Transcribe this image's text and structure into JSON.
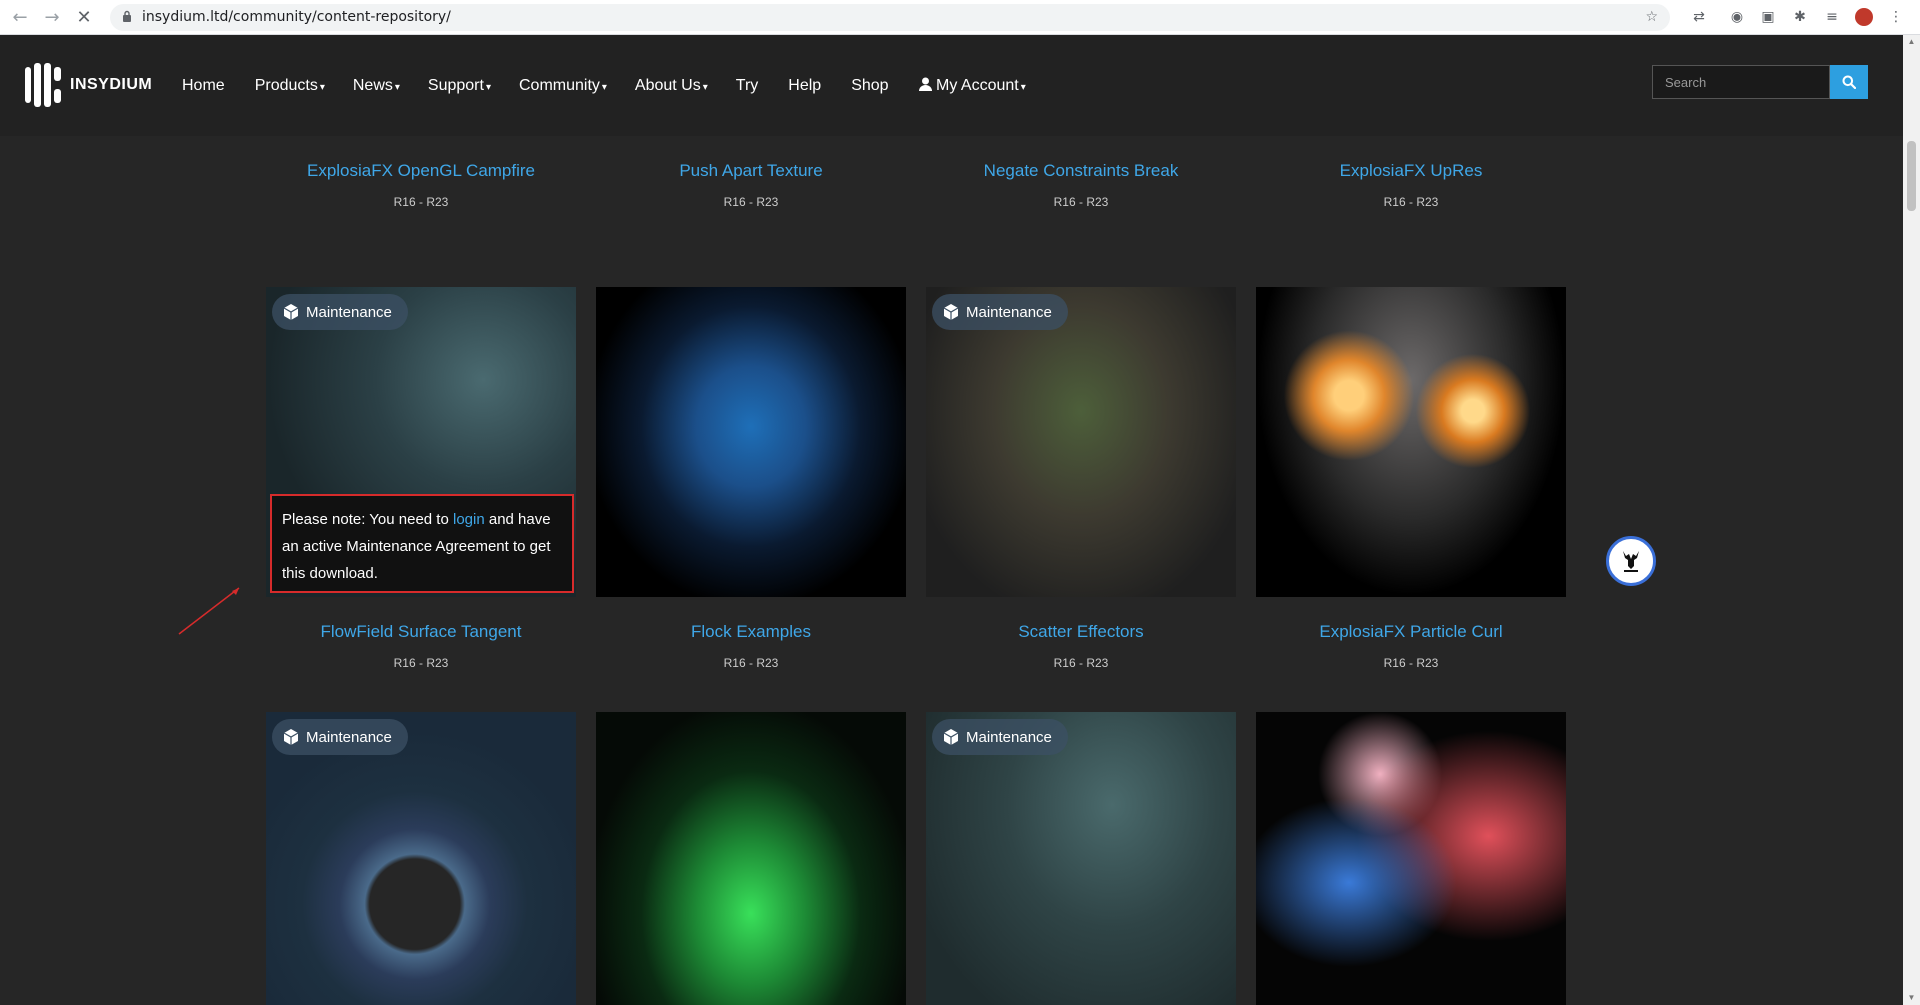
{
  "browser": {
    "url": "insydium.ltd/community/content-repository/"
  },
  "site": {
    "logo_text": "INSYDIUM",
    "nav": [
      {
        "label": "Home",
        "caret": ""
      },
      {
        "label": "Products",
        "caret": "▾"
      },
      {
        "label": "News",
        "caret": "▾"
      },
      {
        "label": "Support",
        "caret": "▾"
      },
      {
        "label": "Community",
        "caret": "▾"
      },
      {
        "label": "About Us",
        "caret": "▾"
      },
      {
        "label": "Try",
        "caret": ""
      },
      {
        "label": "Help",
        "caret": ""
      },
      {
        "label": "Shop",
        "caret": ""
      },
      {
        "label": "My Account",
        "caret": "▾"
      }
    ],
    "search_placeholder": "Search"
  },
  "badge_label": "Maintenance",
  "rows": [
    {
      "cards": [
        {
          "title": "ExplosiaFX OpenGL Campfire",
          "version": "R16 - R23",
          "maintenance": false,
          "thumb": "campfire"
        },
        {
          "title": "Push Apart Texture",
          "version": "R16 - R23",
          "maintenance": false,
          "thumb": "spheres"
        },
        {
          "title": "Negate Constraints Break",
          "version": "R16 - R23",
          "maintenance": false,
          "thumb": "bubbles"
        },
        {
          "title": "ExplosiaFX UpRes",
          "version": "R16 - R23",
          "maintenance": false,
          "thumb": "upres"
        }
      ]
    },
    {
      "cards": [
        {
          "title": "FlowField Surface Tangent",
          "version": "R16 - R23",
          "maintenance": true,
          "thumb": "flowfield"
        },
        {
          "title": "Flock Examples",
          "version": "R16 - R23",
          "maintenance": false,
          "thumb": "flock"
        },
        {
          "title": "Scatter Effectors",
          "version": "R16 - R23",
          "maintenance": true,
          "thumb": "scatter"
        },
        {
          "title": "ExplosiaFX Particle Curl",
          "version": "R16 - R23",
          "maintenance": false,
          "thumb": "fire"
        }
      ]
    },
    {
      "cards": [
        {
          "title": "",
          "version": "",
          "maintenance": true,
          "thumb": "ring"
        },
        {
          "title": "",
          "version": "",
          "maintenance": false,
          "thumb": "green"
        },
        {
          "title": "",
          "version": "",
          "maintenance": true,
          "thumb": "water"
        },
        {
          "title": "",
          "version": "",
          "maintenance": false,
          "thumb": "particles"
        }
      ]
    }
  ],
  "note": {
    "before": "Please note: You need to ",
    "link": "login",
    "after": " and have an active Maintenance Agreement to get this download."
  },
  "colors": {
    "accent": "#3fa7e8",
    "background": "#262626",
    "header": "#222222",
    "note_border": "#d62b2b"
  }
}
